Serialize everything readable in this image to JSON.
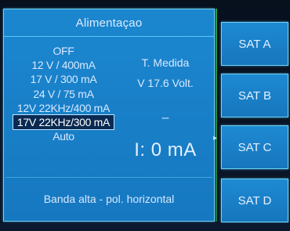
{
  "panel": {
    "title": "Alimentaçao",
    "options": [
      "OFF",
      "12 V / 400mA",
      "17 V / 300 mA",
      "24 V / 75 mA",
      "12V 22KHz/400 mA",
      "17V 22KHz/300 mA",
      "Auto"
    ],
    "selected_option": "17V 22KHz/300 mA",
    "readout": {
      "label": "T. Medida",
      "voltage": "V 17.6 Volt.",
      "dash": "–",
      "current": "I: 0 mA"
    },
    "status": "Banda alta - pol. horizontal"
  },
  "sat_buttons": [
    "SAT A",
    "SAT B",
    "SAT C",
    "SAT D"
  ],
  "colors": {
    "panel_blue": "#1b87cf",
    "border_cyan": "#6fd6f6",
    "selected_bg": "#0a2a52",
    "text": "#d7e8ff"
  }
}
